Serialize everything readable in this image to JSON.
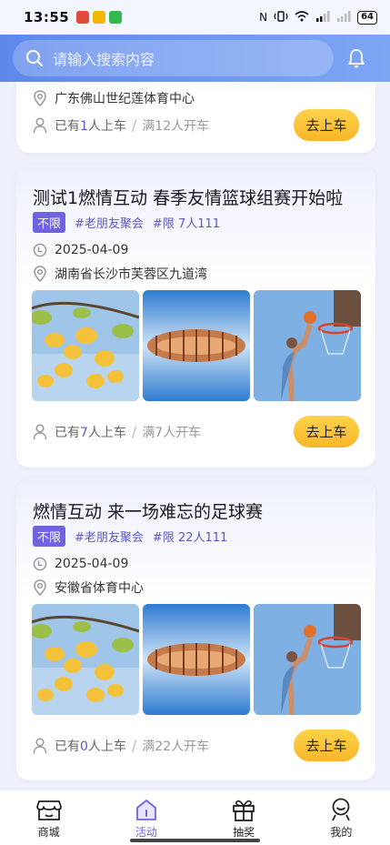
{
  "status": {
    "time": "13:55",
    "battery": "64"
  },
  "search": {
    "placeholder": "请输入搜索内容"
  },
  "icons": {
    "search": "search-icon",
    "bell": "bell-icon",
    "location": "location-pin-icon",
    "clock": "clock-icon",
    "person": "person-icon"
  },
  "colors": {
    "header": "#6a92ef",
    "accent": "#6f63e0",
    "button": "#f9c23c"
  },
  "cards": [
    {
      "location": "广东佛山世纪莲体育中心",
      "joined_prefix": "已有",
      "joined_count": "1",
      "joined_suffix": "人上车",
      "separator": "/",
      "full_text": "满12人开车",
      "button": "去上车"
    },
    {
      "title": "测试1燃情互动 春季友情篮球组赛开始啦",
      "badge": "不限",
      "tag1": "#老朋友聚会",
      "tag2": "#限 7人111",
      "date": "2025-04-09",
      "location": "湖南省长沙市芙蓉区九道湾",
      "joined_prefix": "已有",
      "joined_count": "7",
      "joined_suffix": "人上车",
      "separator": "/",
      "full_text": "满7人开车",
      "button": "去上车"
    },
    {
      "title": "燃情互动 来一场难忘的足球赛",
      "badge": "不限",
      "tag1": "#老朋友聚会",
      "tag2": "#限 22人111",
      "date": "2025-04-09",
      "location": "安徽省体育中心",
      "joined_prefix": "已有",
      "joined_count": "0",
      "joined_suffix": "人上车",
      "separator": "/",
      "full_text": "满22人开车",
      "button": "去上车"
    }
  ],
  "nav": [
    {
      "label": "商城",
      "icon": "shop-icon"
    },
    {
      "label": "活动",
      "icon": "home-icon"
    },
    {
      "label": "抽奖",
      "icon": "gift-icon"
    },
    {
      "label": "我的",
      "icon": "profile-icon"
    }
  ]
}
